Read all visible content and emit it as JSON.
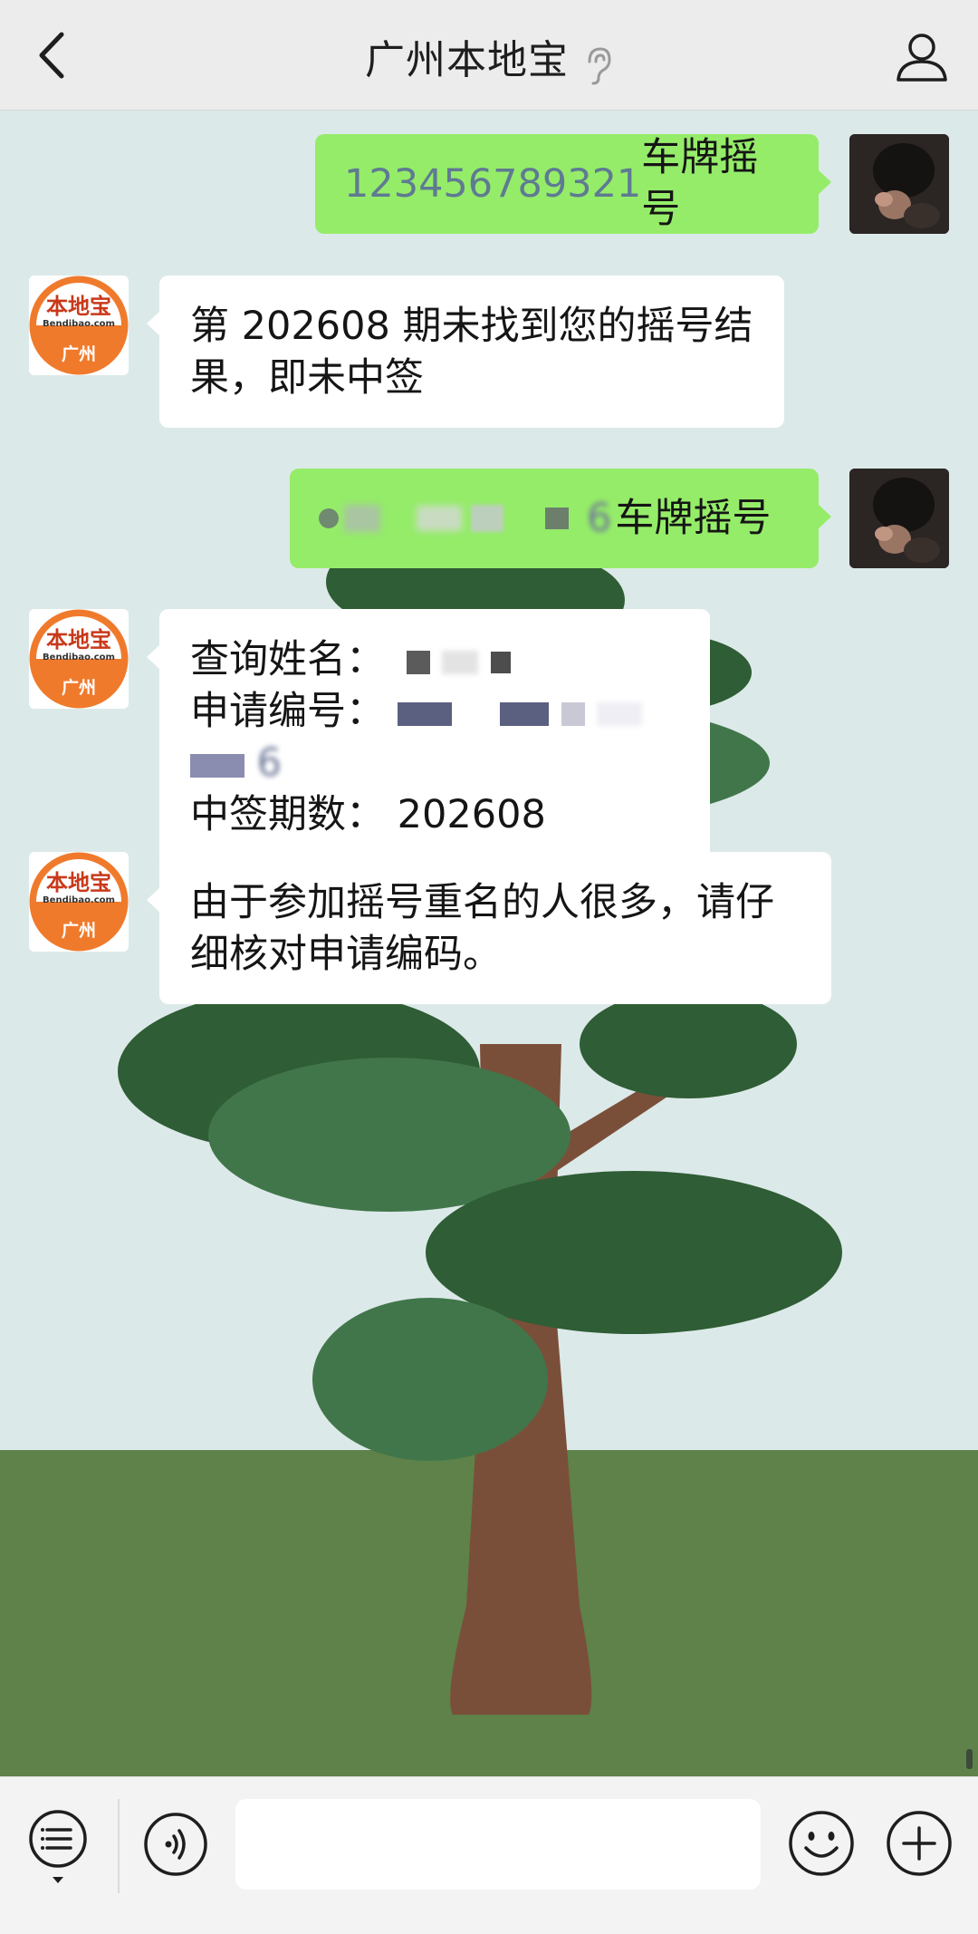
{
  "header": {
    "title": "广州本地宝",
    "icons": {
      "back": "chevron-left-icon",
      "listen": "ear-icon",
      "profile": "user-profile-icon"
    }
  },
  "bot_avatar": {
    "brand": "本地宝",
    "site": "Bendibao.com",
    "city": "广州",
    "color": "#f07a2c"
  },
  "messages": [
    {
      "from": "user",
      "number": "123456789321",
      "suffix": "车牌摇号"
    },
    {
      "from": "bot",
      "lines": [
        "第 202608 期未找到您的摇号结",
        "果，即未中签"
      ]
    },
    {
      "from": "user",
      "number_blurred": "6",
      "suffix": "车牌摇号"
    },
    {
      "from": "bot",
      "name_label": "查询姓名：",
      "code_label": "申请编号：",
      "code_tail": "6",
      "period_label": "中签期数：",
      "period_value": "202608"
    },
    {
      "from": "bot",
      "lines": [
        "由于参加摇号重名的人很多，请仔",
        "细核对申请编码。"
      ]
    }
  ],
  "input_bar": {
    "placeholder": "",
    "icons": {
      "menu": "menu-list-icon",
      "voice": "voice-icon",
      "emoji": "emoji-icon",
      "more": "plus-icon"
    }
  },
  "colors": {
    "outgoing_bubble": "#95ec69",
    "incoming_bubble": "#ffffff",
    "chat_bg": "#dce9e9",
    "ground": "#5e8249"
  }
}
